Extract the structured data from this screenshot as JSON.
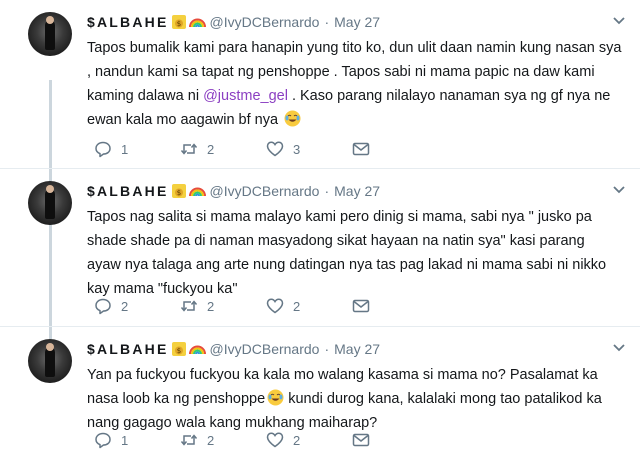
{
  "tweets": [
    {
      "author_name": "$ALBAHE",
      "handle": "@IvyDCBernardo",
      "separator": "·",
      "date": "May 27",
      "body_part1": "Tapos bumalik kami para hanapin yung tito ko, dun ulit daan namin kung nasan sya , nandun kami sa tapat ng penshoppe . Tapos sabi ni mama papic na daw kami kaming dalawa ni ",
      "mention": "@justme_gel",
      "body_part2": "  . Kaso parang nila​layo nanaman sya ng gf nya ne ewan kala mo aagawin bf nya",
      "replies": "1",
      "retweets": "2",
      "likes": "3"
    },
    {
      "author_name": "$ALBAHE",
      "handle": "@IvyDCBernardo",
      "separator": "·",
      "date": "May 27",
      "body": "Tapos nag salita si mama malayo kami pero dinig si mama, sabi nya \" jusko pa shade shade pa di naman masyadong sikat hayaan na natin sya\" kasi parang ayaw nya talaga ang arte nung datingan nya tas pag lakad ni mama sabi ni nikko kay mama \"fuckyou ka\"",
      "replies": "2",
      "retweets": "2",
      "likes": "2"
    },
    {
      "author_name": "$ALBAHE",
      "handle": "@IvyDCBernardo",
      "separator": "·",
      "date": "May 27",
      "body_part1": "Yan pa fuckyou fuckyou ka kala mo walang kasama si mama no? Pasalamat ka nasa loob ka ng penshoppe",
      "body_part2": " kundi durog kana, kalalaki mong tao patalikod ka nang gagago wala kang mukhang maiharap?",
      "replies": "1",
      "retweets": "2",
      "likes": "2"
    }
  ],
  "colors": {
    "text": "#14171a",
    "secondary": "#657786",
    "mention": "#8b3fc2",
    "thread_line": "#ccd6dd"
  },
  "icons": [
    "reply-icon",
    "retweet-icon",
    "like-icon",
    "direct-message-icon",
    "chevron-down-icon",
    "money-bag-emoji",
    "rainbow-emoji",
    "tears-of-joy-emoji"
  ]
}
